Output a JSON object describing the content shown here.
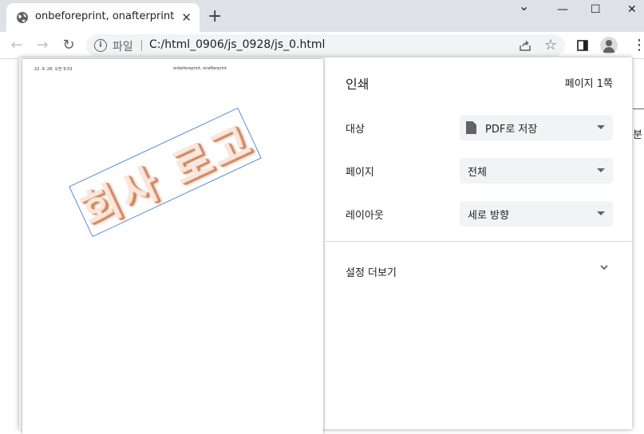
{
  "browser": {
    "tab": {
      "title": "onbeforeprint, onafterprint",
      "close": "✕",
      "favicon": "globe-icon"
    },
    "new_tab": "+",
    "window_controls": {
      "minimize": "—",
      "maximize": "☐",
      "close": "✕",
      "tabsearch": "⌄"
    },
    "nav": {
      "back": "←",
      "forward": "→",
      "reload": "↻"
    },
    "address": {
      "scheme": "파일",
      "url": "C:/html_0906/js_0928/js_0.html"
    },
    "icons": {
      "share": "share-icon",
      "star": "☆",
      "sidepanel": "side-panel-icon",
      "menu": "⋮"
    }
  },
  "background": {
    "edge_text": "분"
  },
  "print_dialog": {
    "preview": {
      "header_date": "22. 9. 28. 오전 9:53",
      "header_title": "onbeforeprint, onafterprint",
      "stamp_text": "회사 로고",
      "colors": {
        "stamp_border": "#5b8bd2",
        "stamp_fill": "#fbe6da",
        "stamp_shadow": "#d88a64"
      }
    },
    "settings": {
      "title": "인쇄",
      "page_count": "페이지 1쪽",
      "destination": {
        "label": "대상",
        "value": "PDF로 저장"
      },
      "pages": {
        "label": "페이지",
        "value": "전체"
      },
      "layout": {
        "label": "레이아웃",
        "value": "세로 방향"
      },
      "more_settings": "설정 더보기"
    }
  }
}
